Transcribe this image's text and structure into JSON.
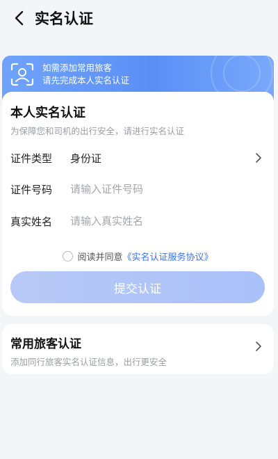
{
  "header": {
    "title": "实名认证"
  },
  "banner": {
    "line1": "如需添加常用旅客",
    "line2": "请先完成本人实名认证"
  },
  "verify_card": {
    "title": "本人实名认证",
    "subtitle": "为保障您和司机的出行安全，请进行实名认证",
    "fields": {
      "id_type": {
        "label": "证件类型",
        "value": "身份证"
      },
      "id_number": {
        "label": "证件号码",
        "placeholder": "请输入证件号码"
      },
      "real_name": {
        "label": "真实姓名",
        "placeholder": "请输入真实姓名"
      }
    },
    "agree": {
      "text": "阅读并同意",
      "link": "《实名认证服务协议》"
    },
    "submit_label": "提交认证"
  },
  "passenger_card": {
    "title": "常用旅客认证",
    "subtitle": "添加同行旅客实名认证信息，出行更安全"
  },
  "colors": {
    "accent": "#3c73ee",
    "banner": "#5b8ff5",
    "button_disabled": "#b9c9f7",
    "background": "#f4f5f9"
  }
}
